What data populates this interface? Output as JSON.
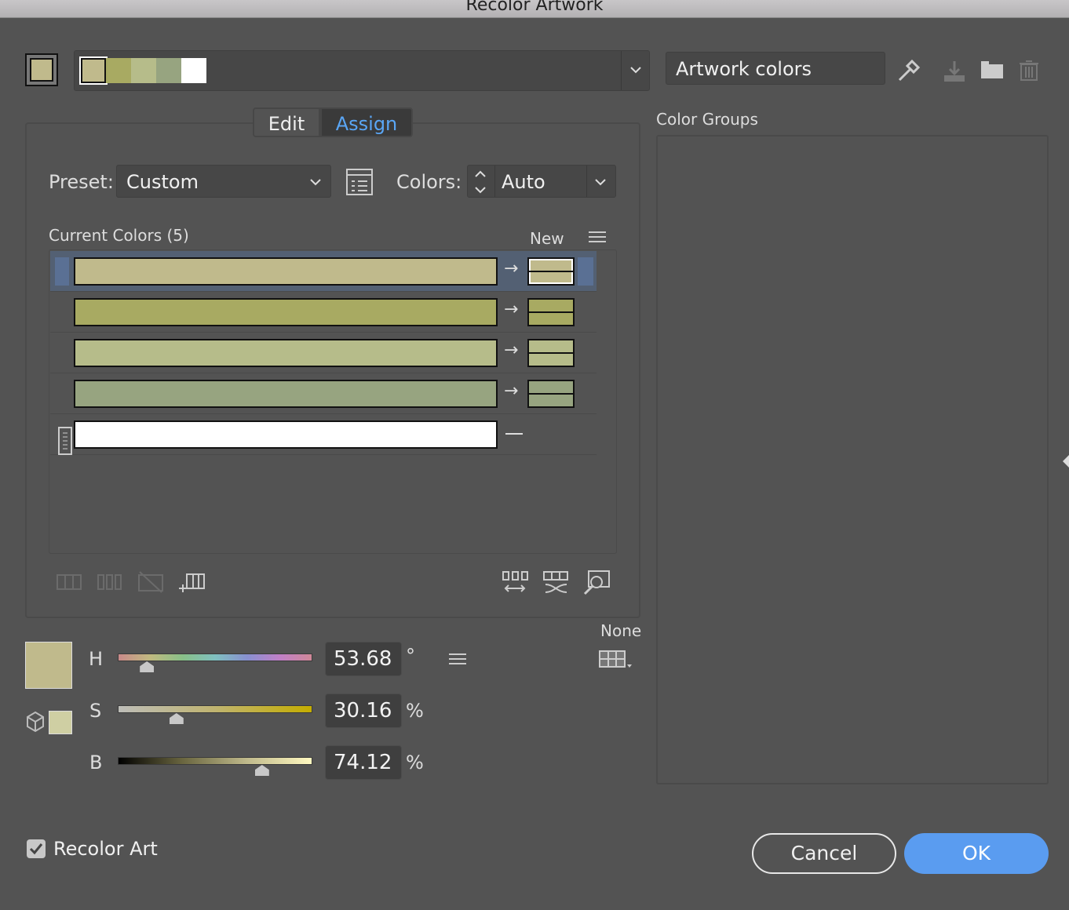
{
  "window": {
    "title": "Recolor Artwork"
  },
  "top": {
    "active_swatch": "#c0ba8c",
    "group_swatches": [
      "#c0ba8c",
      "#a8aa62",
      "#b6bc8a",
      "#97a480",
      "#ffffff"
    ],
    "group_name": "Artwork colors",
    "icons": [
      "eyedropper-icon",
      "save-group-icon",
      "folder-icon",
      "trash-icon"
    ]
  },
  "tabs": [
    {
      "label": "Edit",
      "active": false
    },
    {
      "label": "Assign",
      "active": true
    }
  ],
  "preset": {
    "label": "Preset:",
    "value": "Custom"
  },
  "colors": {
    "label": "Colors:",
    "value": "Auto"
  },
  "list": {
    "title": "Current Colors (5)",
    "new_label": "New",
    "rows": [
      {
        "current": "#c0ba8c",
        "new": "#c0ba8c",
        "selected": true
      },
      {
        "current": "#a8aa62",
        "new": "#a8aa62"
      },
      {
        "current": "#b6bc8a",
        "new": "#b6bc8a"
      },
      {
        "current": "#97a480",
        "new": "#97a480"
      },
      {
        "current": "#ffffff",
        "new": null
      }
    ]
  },
  "sliders": {
    "swatch": "#c0ba8c",
    "small_swatch": "#cfcfa3",
    "h": {
      "label": "H",
      "value": "53.68",
      "unit": "°",
      "fraction": 0.15
    },
    "s": {
      "label": "S",
      "value": "30.16",
      "unit": "%",
      "fraction": 0.3016
    },
    "b": {
      "label": "B",
      "value": "74.12",
      "unit": "%",
      "fraction": 0.7412
    },
    "none_label": "None"
  },
  "color_groups": {
    "title": "Color Groups"
  },
  "footer": {
    "recolor_label": "Recolor Art",
    "recolor_checked": true,
    "cancel": "Cancel",
    "ok": "OK"
  },
  "accent": "#5a9cf0"
}
